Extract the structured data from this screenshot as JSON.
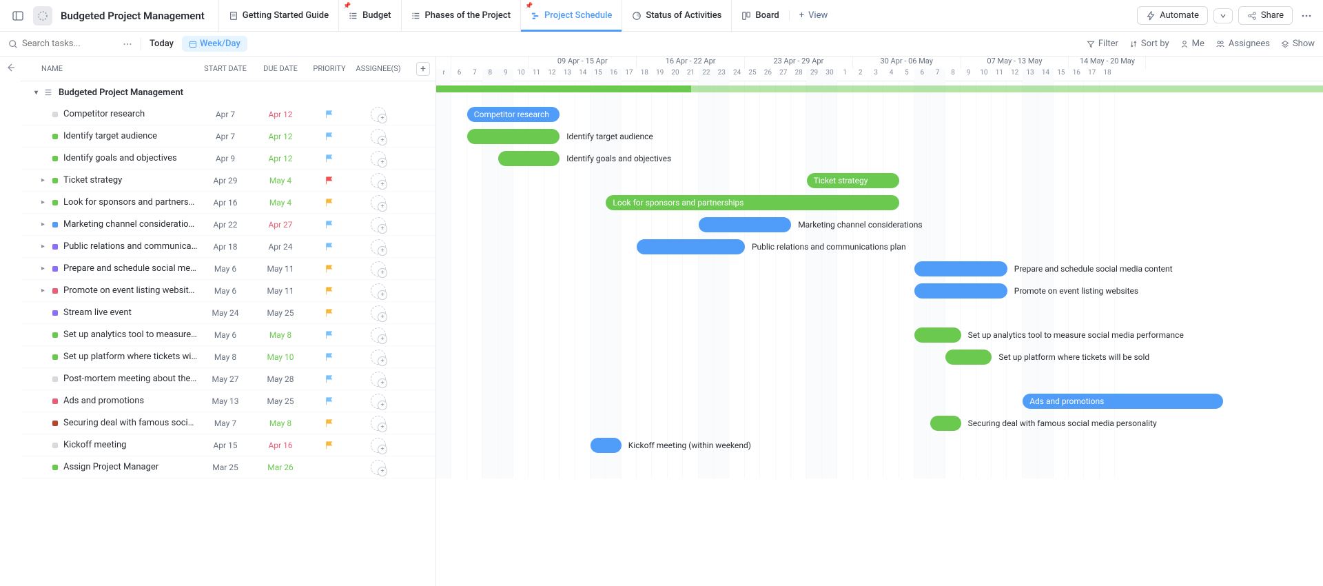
{
  "header": {
    "project_title": "Budgeted Project Management",
    "tabs": [
      {
        "label": "Getting Started Guide",
        "icon": "doc"
      },
      {
        "label": "Budget",
        "icon": "list",
        "pinned": true
      },
      {
        "label": "Phases of the Project",
        "icon": "list"
      },
      {
        "label": "Project Schedule",
        "icon": "gantt",
        "active": true,
        "pinned": true
      },
      {
        "label": "Status of Activities",
        "icon": "pie"
      },
      {
        "label": "Board",
        "icon": "board"
      }
    ],
    "view_label": "View",
    "automate_label": "Automate",
    "share_label": "Share"
  },
  "toolbar": {
    "search_placeholder": "Search tasks...",
    "today_label": "Today",
    "weekday_label": "Week/Day",
    "filter_label": "Filter",
    "sort_label": "Sort by",
    "me_label": "Me",
    "assignees_label": "Assignees",
    "show_label": "Show"
  },
  "columns": {
    "name": "Name",
    "start": "Start Date",
    "due": "Due Date",
    "priority": "Priority",
    "assignee": "Assignee(s)"
  },
  "group_name": "Budgeted Project Management",
  "timeline": {
    "weeks": [
      {
        "label": "",
        "days": 1
      },
      {
        "label": "",
        "days": 5
      },
      {
        "label": "09 Apr - 15 Apr",
        "days": 7
      },
      {
        "label": "16 Apr - 22 Apr",
        "days": 7
      },
      {
        "label": "23 Apr - 29 Apr",
        "days": 7
      },
      {
        "label": "30 Apr - 06 May",
        "days": 7
      },
      {
        "label": "07 May - 13 May",
        "days": 7
      },
      {
        "label": "14 May - 20 May",
        "days": 5
      }
    ],
    "days": [
      "r",
      "6",
      "7",
      "8",
      "9",
      "10",
      "11",
      "12",
      "13",
      "14",
      "15",
      "16",
      "17",
      "18",
      "19",
      "20",
      "21",
      "22",
      "23",
      "24",
      "25",
      "26",
      "27",
      "28",
      "29",
      "30",
      "1",
      "2",
      "3",
      "4",
      "5",
      "6",
      "7",
      "8",
      "9",
      "10",
      "11",
      "12",
      "13",
      "14",
      "15",
      "16",
      "17",
      "18"
    ],
    "weekend_indices": [
      0,
      3,
      4,
      10,
      11,
      17,
      18,
      24,
      25,
      31,
      32,
      38,
      39
    ]
  },
  "tasks": [
    {
      "name": "Competitor research",
      "start": "Apr 7",
      "due": "Apr 12",
      "due_style": "red",
      "flag": "#78c1fa",
      "status": "#d6d9de",
      "bar_start": 2,
      "bar_len": 6,
      "bar_color": "#4f9cf9",
      "bar_text": "Competitor research",
      "label_right": ""
    },
    {
      "name": "Identify target audience",
      "start": "Apr 7",
      "due": "Apr 12",
      "due_style": "green",
      "flag": "#78c1fa",
      "status": "#6bc950",
      "bar_start": 2,
      "bar_len": 6,
      "bar_color": "#6bc950",
      "bar_text": "",
      "label_right": "Identify target audience"
    },
    {
      "name": "Identify goals and objectives",
      "start": "Apr 9",
      "due": "Apr 12",
      "due_style": "green",
      "flag": "#78c1fa",
      "status": "#6bc950",
      "bar_start": 4,
      "bar_len": 4,
      "bar_color": "#6bc950",
      "bar_text": "",
      "label_right": "Identify goals and objectives"
    },
    {
      "name": "Ticket strategy",
      "start": "Apr 29",
      "due": "May 4",
      "due_style": "green",
      "flag": "#f05252",
      "status": "#6bc950",
      "bar_start": 24,
      "bar_len": 6,
      "bar_color": "#6bc950",
      "bar_text": "Ticket strategy",
      "label_right": "",
      "expandable": true
    },
    {
      "name": "Look for sponsors and partnerships",
      "start": "Apr 16",
      "due": "May 4",
      "due_style": "green",
      "flag": "#f6b73c",
      "status": "#6bc950",
      "bar_start": 11,
      "bar_len": 19,
      "bar_color": "#6bc950",
      "bar_text": "Look for sponsors and partnerships",
      "label_right": "",
      "expandable": true
    },
    {
      "name": "Marketing channel considerations",
      "start": "Apr 22",
      "due": "Apr 27",
      "due_style": "red",
      "flag": "#78c1fa",
      "status": "#4f9cf9",
      "bar_start": 17,
      "bar_len": 6,
      "bar_color": "#4f9cf9",
      "bar_text": "",
      "label_right": "Marketing channel considerations",
      "expandable": true
    },
    {
      "name": "Public relations and communications plan",
      "start": "Apr 18",
      "due": "Apr 24",
      "due_style": "",
      "flag": "#78c1fa",
      "status": "#8b6ef5",
      "bar_start": 13,
      "bar_len": 7,
      "bar_color": "#4f9cf9",
      "bar_text": "",
      "label_right": "Public relations and communications plan",
      "expandable": true
    },
    {
      "name": "Prepare and schedule social media content",
      "start": "May 6",
      "due": "May 11",
      "due_style": "",
      "flag": "#f6b73c",
      "status": "#8b6ef5",
      "bar_start": 31,
      "bar_len": 6,
      "bar_color": "#4f9cf9",
      "bar_text": "",
      "label_right": "Prepare and schedule social media content",
      "expandable": true
    },
    {
      "name": "Promote on event listing websites",
      "start": "May 6",
      "due": "May 11",
      "due_style": "",
      "flag": "#f6b73c",
      "status": "#e36078",
      "bar_start": 31,
      "bar_len": 6,
      "bar_color": "#4f9cf9",
      "bar_text": "",
      "label_right": "Promote on event listing websites",
      "expandable": true
    },
    {
      "name": "Stream live event",
      "start": "May 24",
      "due": "May 25",
      "due_style": "",
      "flag": "#f6b73c",
      "status": "#8b6ef5",
      "bar_start": 50,
      "bar_len": 2,
      "bar_color": "#4f9cf9",
      "bar_text": "",
      "label_right": ""
    },
    {
      "name": "Set up analytics tool to measure social media performance",
      "start": "May 6",
      "due": "May 8",
      "due_style": "green",
      "flag": "#78c1fa",
      "status": "#6bc950",
      "bar_start": 31,
      "bar_len": 3,
      "bar_color": "#6bc950",
      "bar_text": "",
      "label_right": "Set up analytics tool to measure social media performance"
    },
    {
      "name": "Set up platform where tickets will be sold",
      "start": "May 8",
      "due": "May 10",
      "due_style": "green",
      "flag": "#78c1fa",
      "status": "#6bc950",
      "bar_start": 33,
      "bar_len": 3,
      "bar_color": "#6bc950",
      "bar_text": "",
      "label_right": "Set up platform where tickets will be sold"
    },
    {
      "name": "Post-mortem meeting about the project",
      "start": "May 27",
      "due": "May 28",
      "due_style": "",
      "flag": "#78c1fa",
      "status": "#d6d9de",
      "bar_start": 53,
      "bar_len": 2,
      "bar_color": "#4f9cf9",
      "bar_text": "",
      "label_right": ""
    },
    {
      "name": "Ads and promotions",
      "start": "May 13",
      "due": "May 25",
      "due_style": "",
      "flag": "#78c1fa",
      "status": "#e36078",
      "bar_start": 38,
      "bar_len": 13,
      "bar_color": "#4f9cf9",
      "bar_text": "Ads and promotions",
      "label_right": ""
    },
    {
      "name": "Securing deal with famous social media personality",
      "start": "May 7",
      "due": "May 8",
      "due_style": "green",
      "flag": "#f6b73c",
      "status": "#b5432f",
      "bar_start": 32,
      "bar_len": 2,
      "bar_color": "#6bc950",
      "bar_text": "",
      "label_right": "Securing deal with famous social media personality"
    },
    {
      "name": "Kickoff meeting",
      "start": "Apr 15",
      "due": "Apr 16",
      "due_style": "red",
      "flag": "#f6b73c",
      "status": "#d6d9de",
      "bar_start": 10,
      "bar_len": 2,
      "bar_color": "#4f9cf9",
      "bar_text": "",
      "label_right": "Kickoff meeting (within weekend)"
    },
    {
      "name": "Assign Project Manager",
      "start": "Mar 25",
      "due": "Mar 26",
      "due_style": "green",
      "flag": "",
      "status": "#6bc950",
      "bar_start": -10,
      "bar_len": 2,
      "bar_color": "#6bc950",
      "bar_text": "",
      "label_right": ""
    }
  ]
}
